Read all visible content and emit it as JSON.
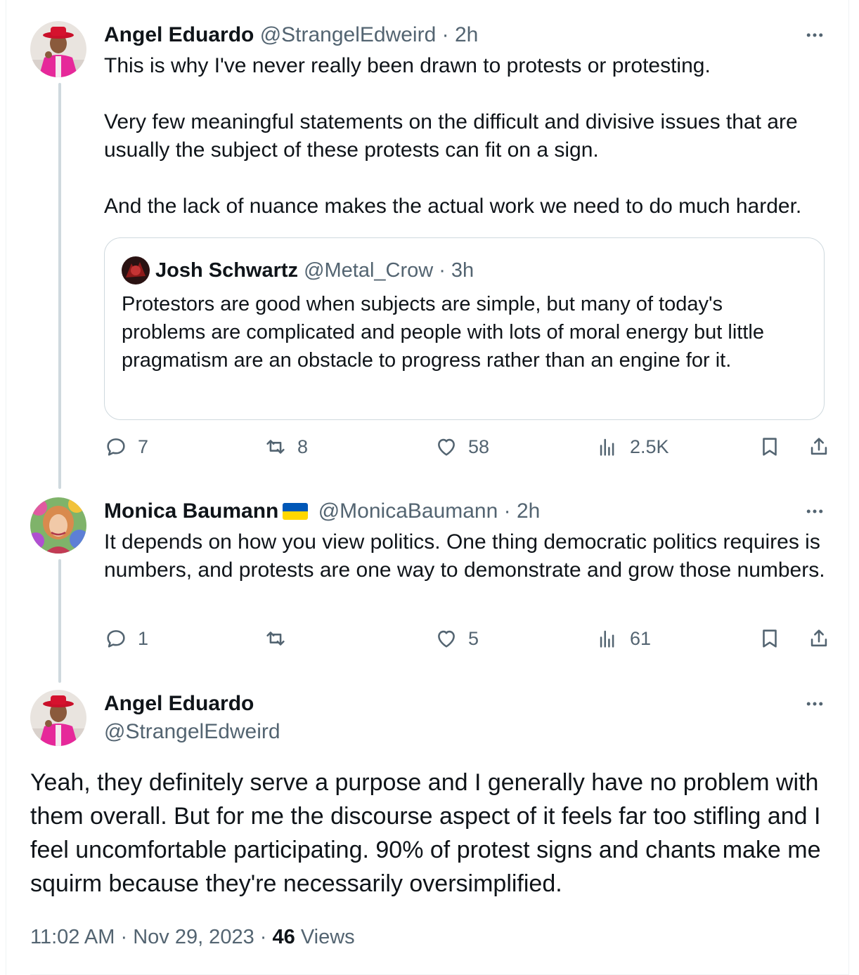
{
  "thread": [
    {
      "author_name": "Angel Eduardo",
      "handle": "@StrangelEdweird",
      "separator": "·",
      "time": "2h",
      "text": "This is why I've never really been drawn to protests or protesting.\n\nVery few meaningful statements on the difficult and divisive issues that are usually the subject of these protests can fit on a sign.\n\nAnd the lack of nuance makes the actual work we need to do much harder.",
      "quote": {
        "author_name": "Josh Schwartz",
        "handle": "@Metal_Crow",
        "separator": "·",
        "time": "3h",
        "text": "Protestors are good when subjects are simple, but many of today's problems are complicated and people with lots of moral energy but little pragmatism are an obstacle to progress rather than an engine for it."
      },
      "actions": {
        "replies": "7",
        "reposts": "8",
        "likes": "58",
        "views": "2.5K"
      }
    },
    {
      "author_name": "Monica Baumann",
      "flag": "ukraine-flag",
      "handle": "@MonicaBaumann",
      "separator": "·",
      "time": "2h",
      "text": "It depends on how you view politics. One thing democratic politics requires is numbers, and protests are one way to demonstrate and grow those numbers.",
      "actions": {
        "replies": "1",
        "reposts": "",
        "likes": "5",
        "views": "61"
      }
    }
  ],
  "main_post": {
    "author_name": "Angel Eduardo",
    "handle": "@StrangelEdweird",
    "text": "Yeah, they definitely serve a purpose and I generally have no problem with them overall. But for me the discourse aspect of it feels far too stifling and I feel uncomfortable participating. 90% of protest signs and chants make me squirm because they're necessarily oversimplified.",
    "time": "11:02 AM",
    "separator1": "·",
    "date": "Nov 29, 2023",
    "separator2": "·",
    "views_count": "46",
    "views_label": "Views"
  },
  "colors": {
    "text": "#0f1419",
    "secondary": "#536471",
    "border": "#cfd9de",
    "ukraine_blue": "#0057b7",
    "ukraine_yellow": "#ffd700"
  }
}
